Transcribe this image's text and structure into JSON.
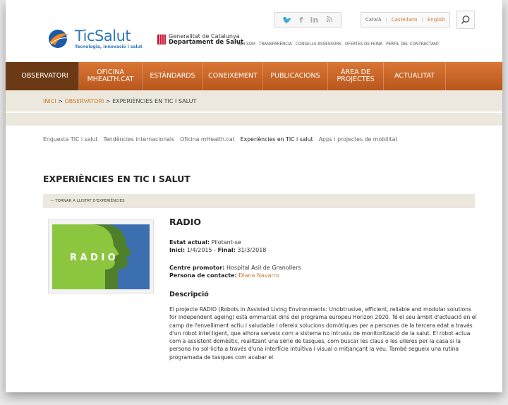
{
  "header": {
    "social": [
      "🐦",
      "f",
      "in",
      "rss"
    ],
    "langs": {
      "ca": "Català",
      "es": "Castellano",
      "en": "English"
    },
    "logo": {
      "name": "TicSalut",
      "tagline": "Tecnologia, innovació i salut"
    },
    "gencat": {
      "line1": "Generalitat de Catalunya",
      "line2": "Departament de Salut"
    },
    "util_links": [
      "QUI SOM",
      "TRANSPARÈNCIA",
      "CONSELLS ASSESSORS",
      "OFERTES DE FEINA",
      "PERFIL DEL CONTRACTANT"
    ]
  },
  "main_nav": [
    {
      "label": "OBSERVATORI"
    },
    {
      "label": "OFICINA MHEALTH.CAT"
    },
    {
      "label": "ESTÀNDARDS"
    },
    {
      "label": "CONEIXEMENT"
    },
    {
      "label": "PUBLICACIONS"
    },
    {
      "label": "ÀREA DE PROJECTES"
    },
    {
      "label": "ACTUALITAT"
    }
  ],
  "breadcrumb": {
    "home": "INICI",
    "sep": " > ",
    "section": "OBSERVATORI",
    "current": "EXPERIÈNCIES EN TIC I SALUT"
  },
  "sub_nav": [
    "Enquesta TIC i salut",
    "Tendències internacionals",
    "Oficina mHealth.cat",
    "Experiències en TIC i salut",
    "Apps i projectes de mobilitat"
  ],
  "page": {
    "title": "EXPERIÈNCIES EN TIC I SALUT",
    "back_link": "— TORNAR A LLISTAT D'EXPERIÈNCIES"
  },
  "project": {
    "logo_text": "R A D I O",
    "name": "RADIO",
    "status_label": "Estat actual:",
    "status": "Pilotant-se",
    "start_label": "Inici:",
    "start": "1/4/2015",
    "end_label": "Final:",
    "end": "31/3/2018",
    "centre_label": "Centre promotor:",
    "centre": "Hospital Asil de Granollers",
    "contact_label": "Persona de contacte:",
    "contact": "Diana Navarro",
    "description_heading": "Descripció",
    "description": "El projecte RADIO (Robots in Assisted Living Environments: Unobtrusive, efficient, reliable and modular solutions for independent ageing) està emmarcat dins del programa europeu Horizon 2020. Té el seu àmbit d'actuació en el camp de l'envelliment actiu i saludable i ofereix solucions domòtiques per a persones de la tercera edat a través d'un robot intel·ligent, que alhora serveix com a sistema no intrusiu de monitorització de la salut. El robot actua com a assistent domèstic, realitzant una sèrie de tasques, com buscar les claus o les ulleres per la casa si la persona ho sol·licita a través d'una interfície intuïtiva i visual o mitjançant la veu. També segueix una rutina programada de tasques com acabar el"
  },
  "colors": {
    "accent": "#c97a32",
    "nav": "#c8632a",
    "nav_active": "#6b3a15",
    "bar": "#ece8dd"
  }
}
